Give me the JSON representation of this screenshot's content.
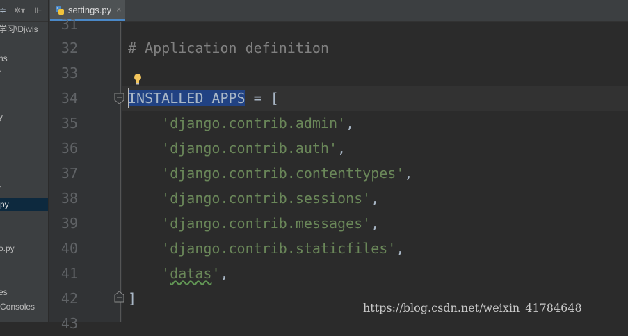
{
  "sidebar": {
    "toolbar": {
      "left_glyph": "≑",
      "gear_glyph": "✲▾",
      "hide_glyph": "⊩"
    },
    "path_fragment": "学习\\Dj\\vis",
    "items": [
      {
        "label": "ns"
      },
      {
        "label": "r"
      },
      {
        "label": "y"
      },
      {
        "label": "r"
      },
      {
        "label": "py",
        "selected": true
      },
      {
        "label": "o.py"
      },
      {
        "label": "es"
      },
      {
        "label": "Consoles"
      }
    ]
  },
  "tab": {
    "label": "settings.py",
    "close": "×"
  },
  "editor": {
    "line_numbers": [
      "31",
      "32",
      "33",
      "34",
      "35",
      "36",
      "37",
      "38",
      "39",
      "40",
      "41",
      "42",
      "43"
    ],
    "lines": {
      "l32": "# Application definition",
      "l34_var": "INSTALLED_APPS",
      "l34_rest": " = [",
      "apps": [
        "'django.contrib.admin'",
        "'django.contrib.auth'",
        "'django.contrib.contenttypes'",
        "'django.contrib.sessions'",
        "'django.contrib.messages'",
        "'django.contrib.staticfiles'"
      ],
      "l41_q1": "'",
      "l41_word": "datas",
      "l41_q2": "'",
      "comma": ",",
      "l42": "]"
    }
  },
  "watermark": "https://blog.csdn.net/weixin_41784648",
  "colors": {
    "comment": "#808080",
    "string": "#6a8759",
    "selection": "#214283",
    "text": "#a9b7c6"
  }
}
